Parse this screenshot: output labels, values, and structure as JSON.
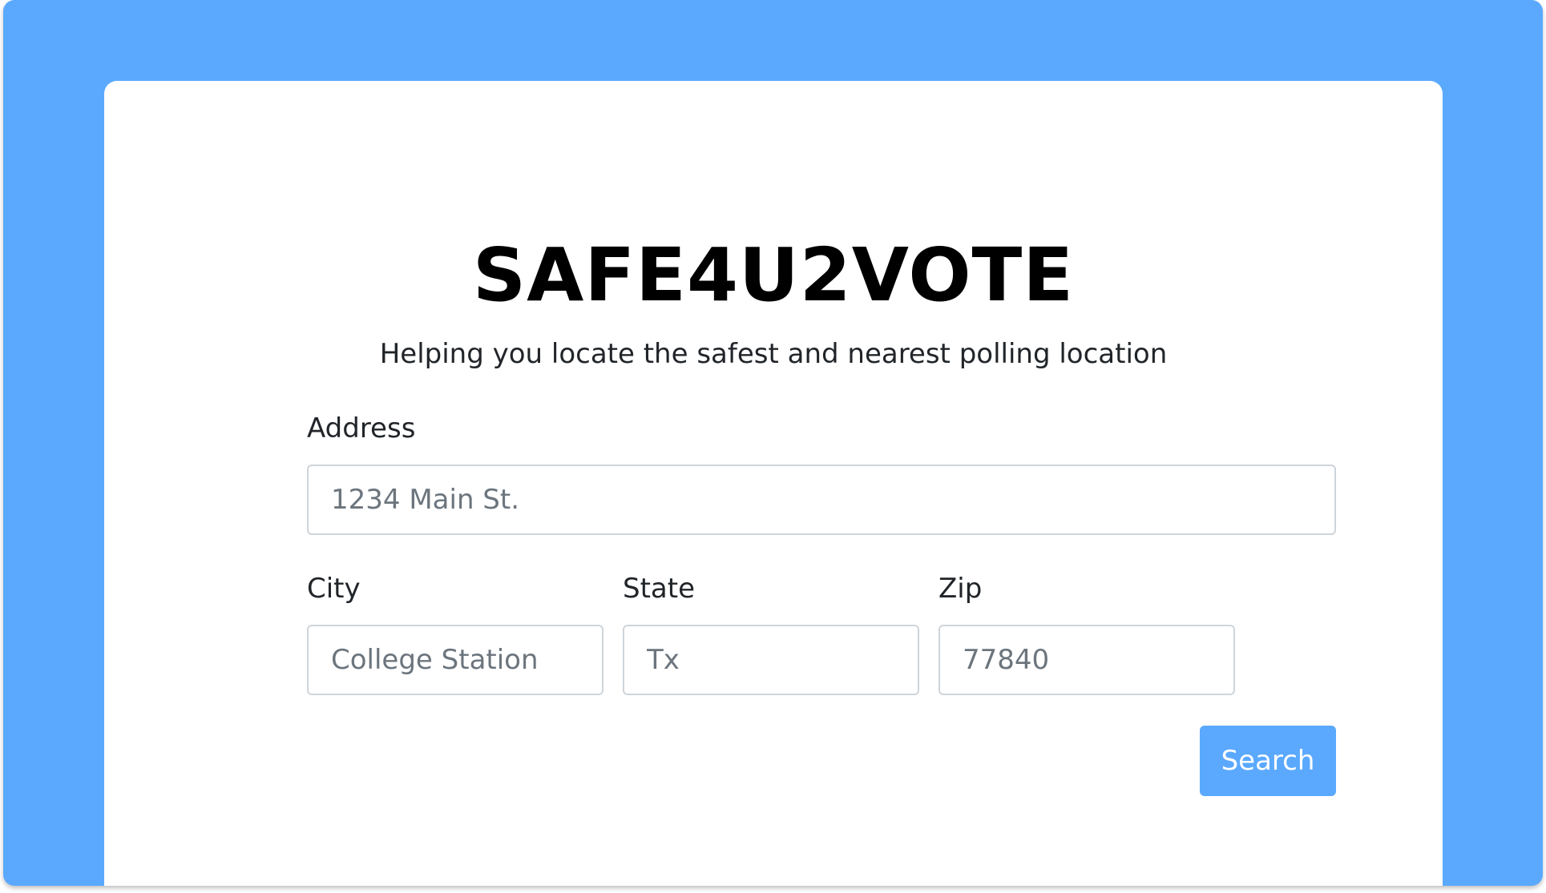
{
  "header": {
    "title": "SAFE4U2VOTE",
    "subtitle": "Helping you locate the safest and nearest polling location"
  },
  "form": {
    "address": {
      "label": "Address",
      "placeholder": "1234 Main St."
    },
    "city": {
      "label": "City",
      "placeholder": "College Station"
    },
    "state": {
      "label": "State",
      "placeholder": "Tx"
    },
    "zip": {
      "label": "Zip",
      "placeholder": "77840"
    },
    "search_label": "Search"
  },
  "colors": {
    "background": "#5aa9fe",
    "card": "#ffffff",
    "button": "#5aa9fe",
    "input_border": "#ced4da"
  }
}
